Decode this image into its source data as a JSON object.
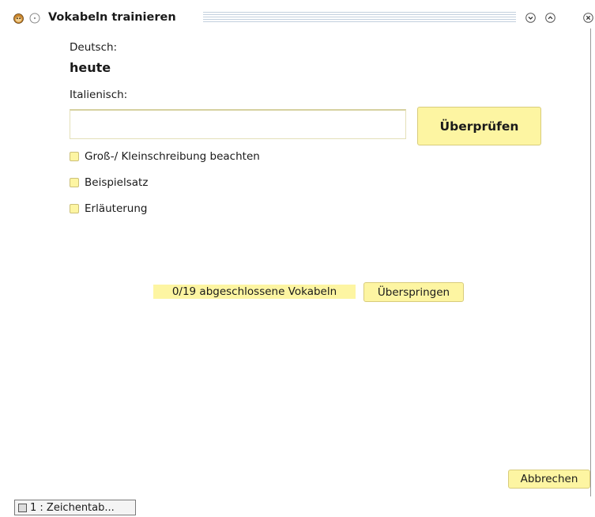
{
  "window": {
    "title": "Vokabeln trainieren",
    "icons": [
      "monkey-icon",
      "circle-icon",
      "chevron-down-icon",
      "chevron-up-icon",
      "close-icon"
    ]
  },
  "quiz": {
    "source_language_label": "Deutsch:",
    "source_word": "heute",
    "target_language_label": "Italienisch:",
    "answer_value": "",
    "check_button_label": "Überprüfen"
  },
  "options": {
    "case_sensitive_label": "Groß-/ Kleinschreibung beachten",
    "example_sentence_label": "Beispielsatz",
    "explanation_label": "Erläuterung"
  },
  "progress": {
    "text": "0/19 abgeschlossene Vokabeln",
    "completed": 0,
    "total": 19,
    "skip_button_label": "Überspringen"
  },
  "footer": {
    "cancel_button_label": "Abbrechen"
  },
  "taskbar": {
    "item_label": "1 : Zeichentab..."
  },
  "colors": {
    "accent_yellow": "#fdf5a2",
    "button_border": "#d8cc7c",
    "title_stripes": "#b8c8d8"
  }
}
